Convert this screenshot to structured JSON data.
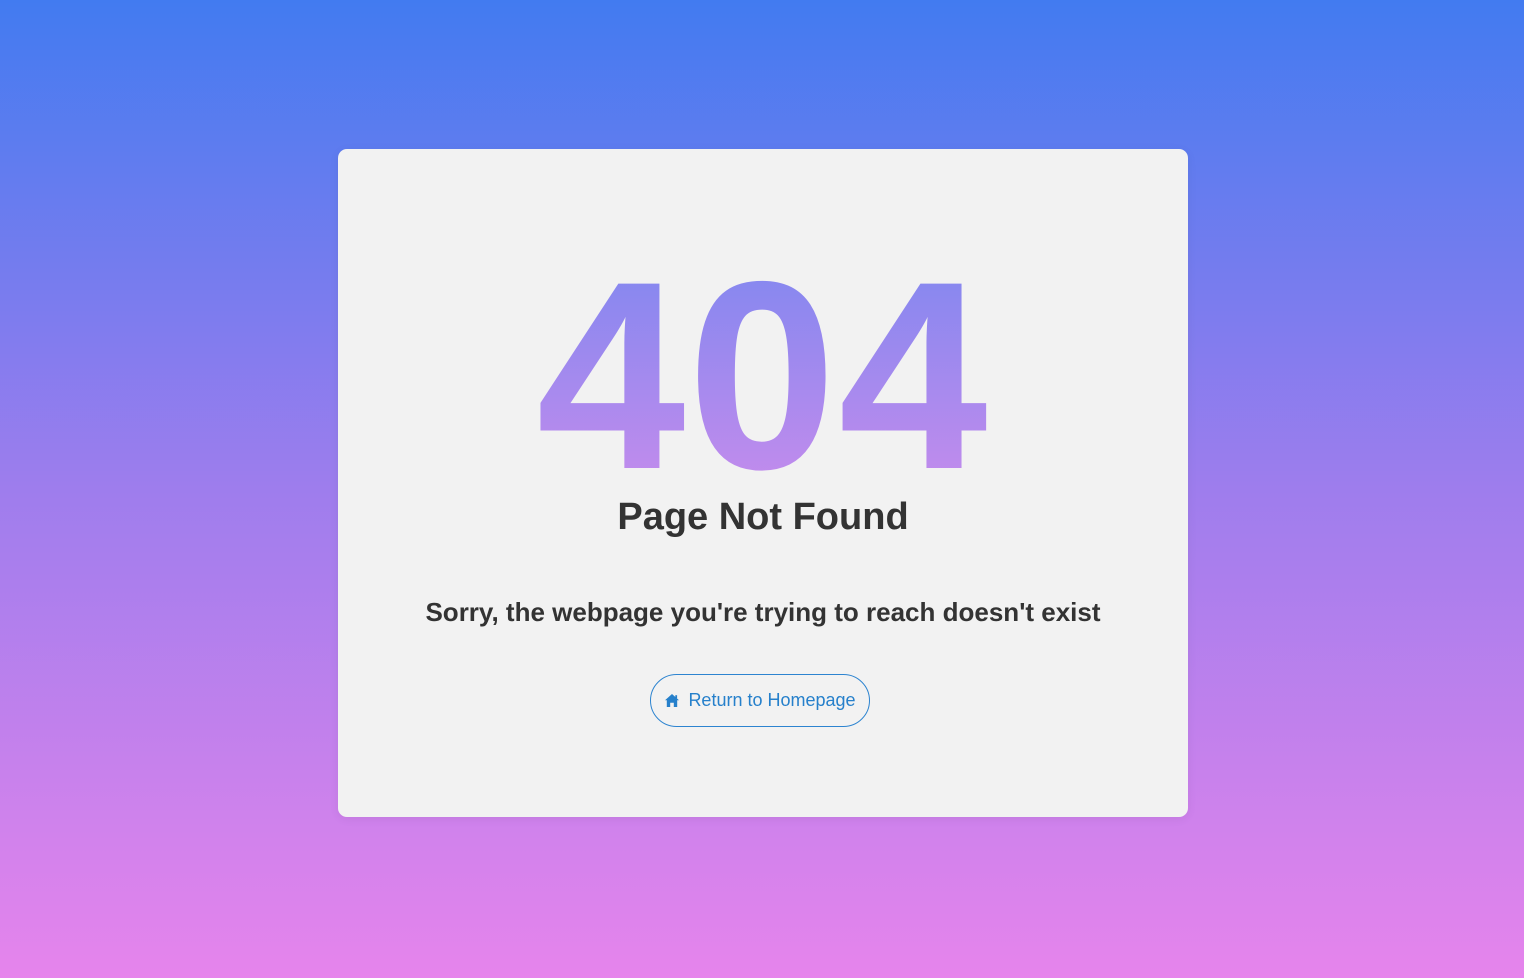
{
  "error": {
    "code": "404",
    "title": "Page Not Found",
    "message": "Sorry, the webpage you're trying to reach doesn't exist"
  },
  "actions": {
    "home_button_label": "Return to Homepage",
    "home_button_icon": "home-icon"
  },
  "colors": {
    "background_top": "#427bf0",
    "background_bottom": "#e684ec",
    "card": "#f2f2f2",
    "code_gradient_top": "#7d87f0",
    "code_gradient_bottom": "#c98cec",
    "text": "#333333",
    "button": "#2680cb"
  }
}
